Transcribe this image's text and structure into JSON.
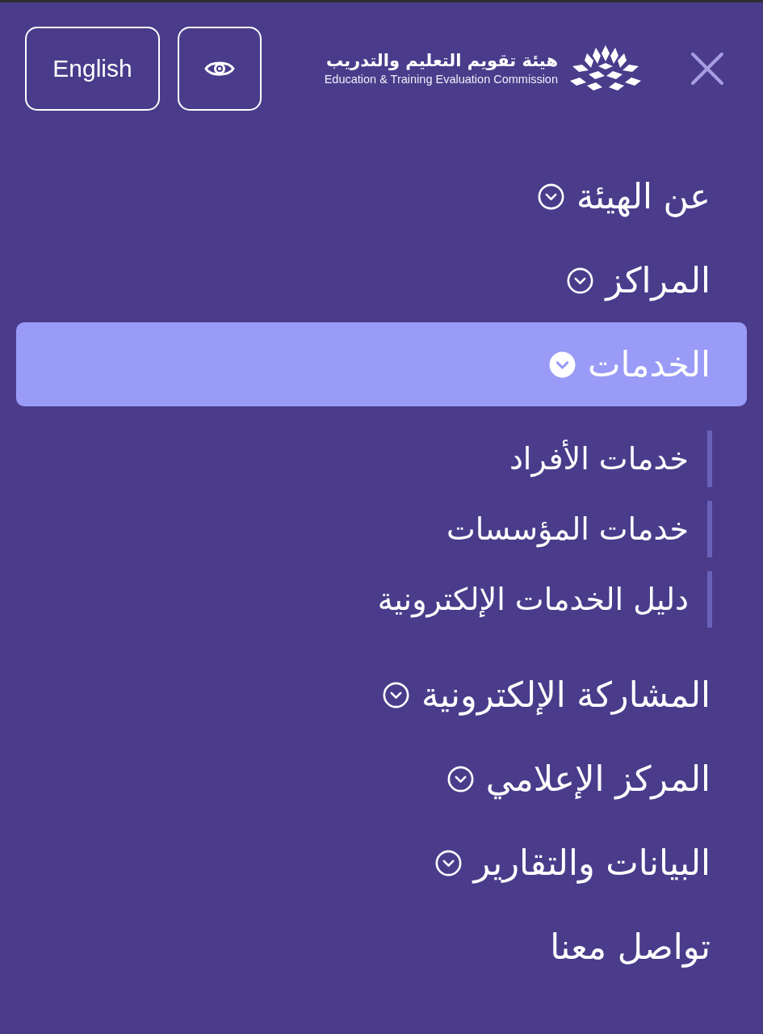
{
  "header": {
    "language_button": "English",
    "logo": {
      "name_ar": "هيئة تقويم التعليم والتدريب",
      "name_en": "Education & Training Evaluation Commission"
    }
  },
  "menu": [
    {
      "label": "عن الهيئة",
      "kind": "dropdown",
      "expanded": false,
      "selected": false
    },
    {
      "label": "المراكز",
      "kind": "dropdown",
      "expanded": false,
      "selected": false
    },
    {
      "label": "الخدمات",
      "kind": "dropdown",
      "expanded": true,
      "selected": true,
      "children": [
        {
          "label": "خدمات الأفراد"
        },
        {
          "label": "خدمات المؤسسات"
        },
        {
          "label": "دليل الخدمات الإلكترونية"
        }
      ]
    },
    {
      "label": "المشاركة الإلكترونية",
      "kind": "dropdown",
      "expanded": false,
      "selected": false
    },
    {
      "label": "المركز الإعلامي",
      "kind": "dropdown",
      "expanded": false,
      "selected": false
    },
    {
      "label": "البيانات والتقارير",
      "kind": "dropdown",
      "expanded": false,
      "selected": false
    },
    {
      "label": "تواصل معنا",
      "kind": "link",
      "selected": false
    }
  ]
}
